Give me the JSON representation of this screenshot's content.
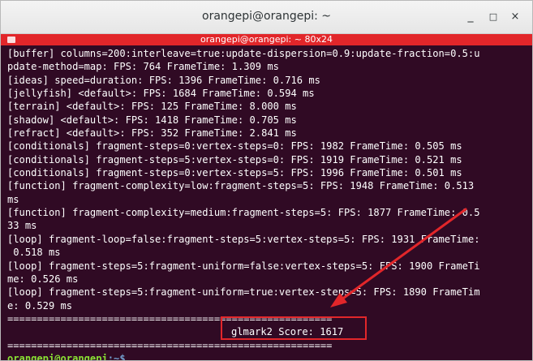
{
  "window": {
    "title": "orangepi@orangepi: ~",
    "minimize_glyph": "_",
    "maximize_glyph": "□",
    "close_glyph": "×"
  },
  "tab": {
    "title": "orangepi@orangepi: ~ 80x24",
    "icon": "terminal-tab-icon"
  },
  "terminal": {
    "lines": [
      "[buffer] columns=200:interleave=true:update-dispersion=0.9:update-fraction=0.5:u",
      "pdate-method=map: FPS: 764 FrameTime: 1.309 ms",
      "[ideas] speed=duration: FPS: 1396 FrameTime: 0.716 ms",
      "[jellyfish] <default>: FPS: 1684 FrameTime: 0.594 ms",
      "[terrain] <default>: FPS: 125 FrameTime: 8.000 ms",
      "[shadow] <default>: FPS: 1418 FrameTime: 0.705 ms",
      "[refract] <default>: FPS: 352 FrameTime: 2.841 ms",
      "[conditionals] fragment-steps=0:vertex-steps=0: FPS: 1982 FrameTime: 0.505 ms",
      "[conditionals] fragment-steps=5:vertex-steps=0: FPS: 1919 FrameTime: 0.521 ms",
      "[conditionals] fragment-steps=0:vertex-steps=5: FPS: 1996 FrameTime: 0.501 ms",
      "[function] fragment-complexity=low:fragment-steps=5: FPS: 1948 FrameTime: 0.513",
      "ms",
      "[function] fragment-complexity=medium:fragment-steps=5: FPS: 1877 FrameTime: 0.5",
      "33 ms",
      "[loop] fragment-loop=false:fragment-steps=5:vertex-steps=5: FPS: 1931 FrameTime:",
      " 0.518 ms",
      "[loop] fragment-steps=5:fragment-uniform=false:vertex-steps=5: FPS: 1900 FrameTi",
      "me: 0.526 ms",
      "[loop] fragment-steps=5:fragment-uniform=true:vertex-steps=5: FPS: 1890 FrameTim",
      "e: 0.529 ms",
      "=======================================================",
      "                                  glmark2 Score: 1617",
      "======================================================="
    ],
    "score_text": "glmark2 Score: 1617",
    "prompt_user": "orangepi@orangepi",
    "prompt_path": ":~$",
    "cursor": " "
  },
  "colors": {
    "terminal_bg": "#300a24",
    "tab_bar": "#e2262a",
    "highlight": "#e2262a",
    "prompt_user": "#8ae234",
    "prompt_path": "#729fcf"
  }
}
